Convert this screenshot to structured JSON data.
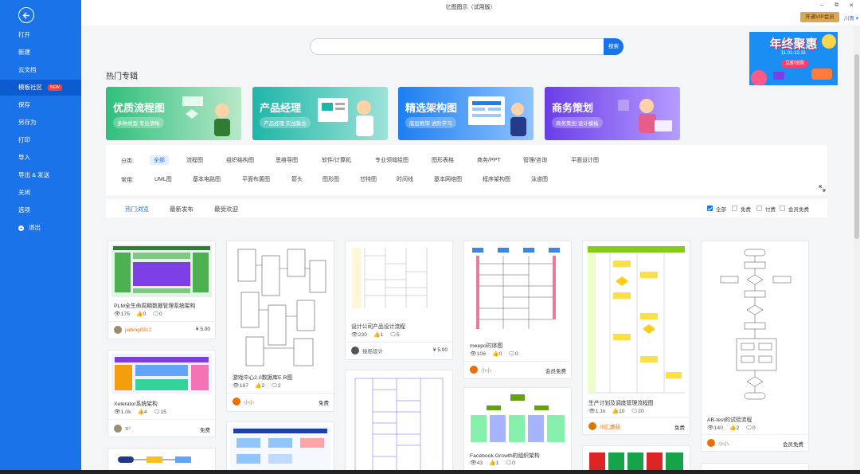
{
  "window": {
    "title": "亿图图示（试用版）",
    "minimize": "–",
    "restore": "⧉",
    "close": "✕"
  },
  "sidebar": {
    "items": [
      {
        "label": "打开"
      },
      {
        "label": "新建"
      },
      {
        "label": "云文档"
      },
      {
        "label": "模板社区",
        "badge": "NEW"
      },
      {
        "label": "保存"
      },
      {
        "label": "另存为"
      },
      {
        "label": "打印"
      },
      {
        "label": "导入"
      },
      {
        "label": "导出 & 发送"
      },
      {
        "label": "关闭"
      },
      {
        "label": "选项"
      },
      {
        "label": "退出"
      }
    ]
  },
  "header": {
    "vip_button": "开通VIP会员",
    "user_name": "川青"
  },
  "search": {
    "placeholder": "",
    "button": "搜索"
  },
  "ad": {
    "title": "年终聚惠",
    "subtitle": "11.01-12.31",
    "button": "立即抢购"
  },
  "section_title": "热门专辑",
  "features": [
    {
      "title": "优质流程图",
      "subtitle": "多种类型 专业清晰"
    },
    {
      "title": "产品经理",
      "subtitle": "产品经理 实战集合"
    },
    {
      "title": "精选架构图",
      "subtitle": "底层框架 进阶学习"
    },
    {
      "title": "商务策划",
      "subtitle": "商务策划 设计模板"
    }
  ],
  "filter": {
    "category_label": "分类:",
    "categories": [
      "全部",
      "流程图",
      "组织结构图",
      "思维导图",
      "软件/计算机",
      "专业领域绘图",
      "图形表格",
      "商务/PPT",
      "管理/咨询",
      "平面设计图"
    ],
    "common_label": "常用:",
    "common": [
      "UML图",
      "基本电路图",
      "平面布置图",
      "箭头",
      "图形图",
      "甘特图",
      "时间线",
      "基本网络图",
      "程序架构图",
      "泳道图"
    ]
  },
  "tabs": [
    "热门浏览",
    "最新发布",
    "最受欢迎"
  ],
  "checkboxes": [
    {
      "label": "全部",
      "checked": true
    },
    {
      "label": "免费",
      "checked": false
    },
    {
      "label": "付费",
      "checked": false
    },
    {
      "label": "会员免费",
      "checked": false
    }
  ],
  "cards": [
    {
      "title": "PLM全生命周期数据管理系统架构",
      "views": "175",
      "likes": "0",
      "comments": "0",
      "author": "jiabing0312",
      "price": "¥ 5.00"
    },
    {
      "title": "Xelerator系统架构",
      "views": "1.0k",
      "likes": "4",
      "comments": "15",
      "author": "π²",
      "price": "免费"
    },
    {
      "title": "游戏中心2.0数据库E R图",
      "views": "187",
      "likes": "2",
      "comments": "2",
      "author": "小小",
      "price": "免费"
    },
    {
      "title": "设计公司产品设计流程",
      "views": "230",
      "likes": "1",
      "comments": "5",
      "author": "接船设计",
      "price": "¥ 5.00"
    },
    {
      "title": "meepo时序图",
      "views": "106",
      "likes": "0",
      "comments": "0",
      "author": "小小",
      "price": "会员免费"
    },
    {
      "title": "Facebook Growth的组织架构",
      "views": "43",
      "likes": "1",
      "comments": "0",
      "author": "",
      "price": ""
    },
    {
      "title": "生产计划及调度管理流程图",
      "views": "1.1k",
      "likes": "10",
      "comments": "20",
      "author": "川汇蘑菇",
      "price": "免费"
    },
    {
      "title": "AB-test的试验流程",
      "views": "140",
      "likes": "2",
      "comments": "0",
      "author": "小小",
      "price": "会员免费"
    }
  ]
}
